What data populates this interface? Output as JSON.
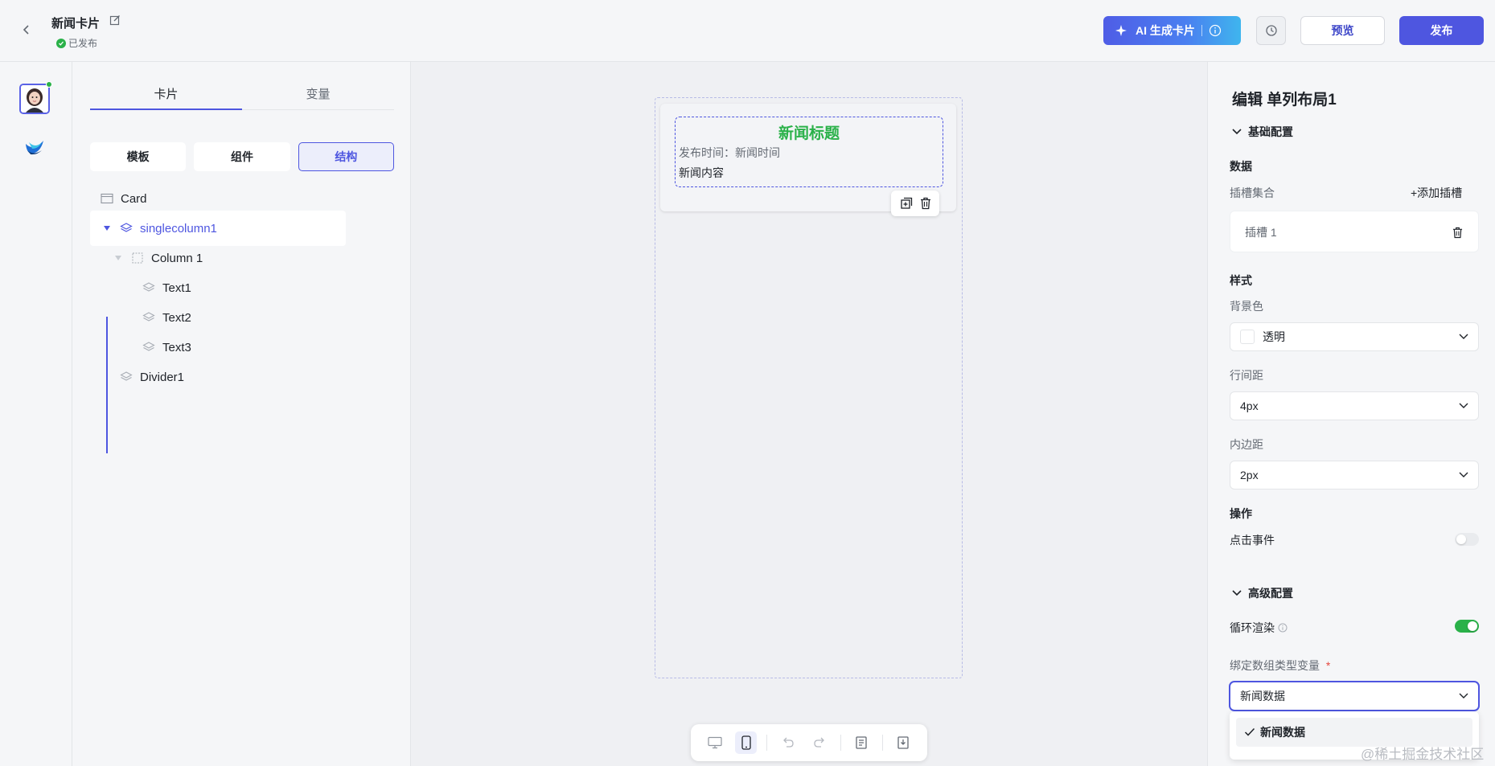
{
  "header": {
    "title": "新闻卡片",
    "status": "已发布",
    "ai_button": "AI 生成卡片",
    "preview": "预览",
    "publish": "发布",
    "icons": [
      "back-icon",
      "edit-icon",
      "check-circle-icon",
      "sparkle-icon",
      "info-icon",
      "history-icon"
    ]
  },
  "structure_panel": {
    "tabs": [
      "卡片",
      "变量"
    ],
    "active_tab": "卡片",
    "segments": [
      "模板",
      "组件",
      "结构"
    ],
    "active_segment": "结构",
    "tree": [
      {
        "label": "Card",
        "icon": "card-icon"
      },
      {
        "label": "singlecolumn1",
        "icon": "layers-icon",
        "selected": true
      },
      {
        "label": "Column 1",
        "icon": "dashed-box-icon"
      },
      {
        "label": "Text1",
        "icon": "layers-icon"
      },
      {
        "label": "Text2",
        "icon": "layers-icon"
      },
      {
        "label": "Text3",
        "icon": "layers-icon"
      },
      {
        "label": "Divider1",
        "icon": "layers-icon"
      }
    ]
  },
  "canvas": {
    "news_title": "新闻标题",
    "news_time": "发布时间：新闻时间",
    "news_content": "新闻内容",
    "toolbar_icons": [
      "desktop-icon",
      "mobile-icon",
      "undo-icon",
      "redo-icon",
      "document-icon",
      "export-icon"
    ]
  },
  "props": {
    "title": "编辑 单列布局1",
    "basic_section": "基础配置",
    "data_label": "数据",
    "slots_label": "插槽集合",
    "add_slot": "+添加插槽",
    "slot_name": "插槽 1",
    "style_label": "样式",
    "bg_label": "背景色",
    "bg_value": "透明",
    "line_spacing_label": "行间距",
    "line_spacing_value": "4px",
    "padding_label": "内边距",
    "padding_value": "2px",
    "action_label": "操作",
    "click_event_label": "点击事件",
    "click_event_on": false,
    "advanced_section": "高级配置",
    "loop_render_label": "循环渲染",
    "loop_render_on": true,
    "bind_label": "绑定数组类型变量",
    "required_mark": "*",
    "bind_value": "新闻数据",
    "dropdown_option": "新闻数据"
  },
  "watermark": "@稀土掘金技术社区",
  "colors": {
    "accent": "#4e56e0",
    "green": "#2ab149"
  }
}
